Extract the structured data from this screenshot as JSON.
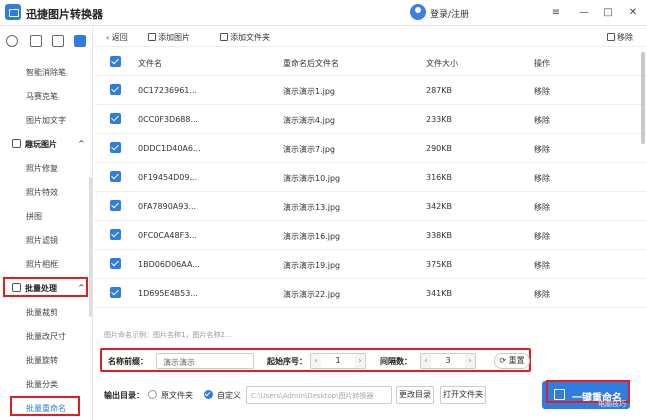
{
  "app": {
    "title": "迅捷图片转换器",
    "login": "登录/注册",
    "window": {
      "minimize": "—",
      "restore": "□",
      "close": "✕",
      "menu": "≡"
    }
  },
  "sidebar": {
    "items_top": [
      "智能消除笔",
      "马赛克笔",
      "图片加文字"
    ],
    "group_fun": "趣玩图片",
    "items_fun": [
      "照片修复",
      "照片特效",
      "拼图",
      "照片滤镜",
      "照片相框"
    ],
    "group_batch": "批量处理",
    "items_batch": [
      "批量裁剪",
      "批量改尺寸",
      "批量旋转",
      "批量分类",
      "批量重命名"
    ]
  },
  "toolbar": {
    "back": "返回",
    "add_image": "添加图片",
    "add_folder": "添加文件夹",
    "remove": "移除"
  },
  "table": {
    "headers": [
      "文件名",
      "重命名后文件名",
      "文件大小",
      "操作"
    ],
    "rows": [
      {
        "name": "0C17236961...",
        "renamed": "演示演示1.jpg",
        "size": "287KB",
        "action": "移除"
      },
      {
        "name": "0CC0F3D688...",
        "renamed": "演示演示4.jpg",
        "size": "233KB",
        "action": "移除"
      },
      {
        "name": "0DDC1D40A6...",
        "renamed": "演示演示7.jpg",
        "size": "290KB",
        "action": "移除"
      },
      {
        "name": "0F19454D09...",
        "renamed": "演示演示10.jpg",
        "size": "316KB",
        "action": "移除"
      },
      {
        "name": "0FA7890A93...",
        "renamed": "演示演示13.jpg",
        "size": "342KB",
        "action": "移除"
      },
      {
        "name": "0FC0CA48F3...",
        "renamed": "演示演示16.jpg",
        "size": "338KB",
        "action": "移除"
      },
      {
        "name": "1BD06D06AA...",
        "renamed": "演示演示19.jpg",
        "size": "375KB",
        "action": "移除"
      },
      {
        "name": "1D695E4B53...",
        "renamed": "演示演示22.jpg",
        "size": "341KB",
        "action": "移除"
      }
    ]
  },
  "hint": "图片命名示例：图片名称1，图片名称2...",
  "settings": {
    "prefix_label": "名称前缀：",
    "prefix_value": "演示演示",
    "start_label": "起始序号：",
    "start_value": "1",
    "step_label": "间隔数：",
    "step_value": "3",
    "reset": "重置"
  },
  "output": {
    "label": "输出目录：",
    "opt_original": "原文件夹",
    "opt_custom": "自定义",
    "path": "C:\\Users\\Admin\\Desktop\\图片转换器",
    "change_dir": "更改目录",
    "open_folder": "打开文件夹",
    "rename_button": "一键重命名"
  },
  "watermark": "电脑技巧"
}
